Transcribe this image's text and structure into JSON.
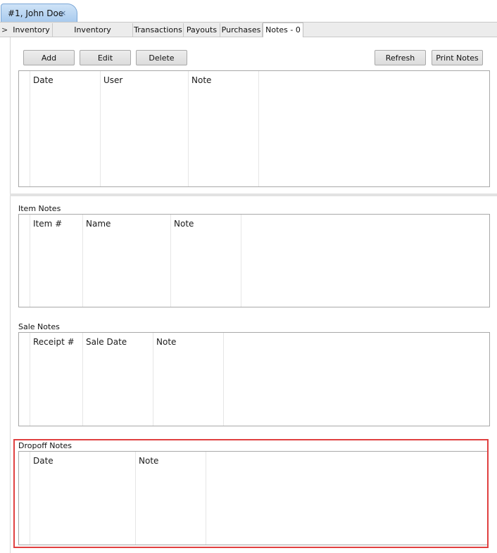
{
  "doc_tab": {
    "label": "#1, John Doe",
    "close_glyph": "×"
  },
  "subtabs": {
    "arrow": ">",
    "items": [
      "Inventory",
      "Inventory Disposition",
      "Transactions",
      "Payouts",
      "Purchases",
      "Notes - 0"
    ],
    "active": "Notes - 0"
  },
  "toolbar": {
    "add": "Add",
    "edit": "Edit",
    "delete": "Delete",
    "refresh": "Refresh",
    "print_notes": "Print Notes"
  },
  "notes_table": {
    "columns": [
      "Date",
      "User",
      "Note"
    ]
  },
  "item_notes": {
    "title": "Item Notes",
    "columns": [
      "Item #",
      "Name",
      "Note"
    ]
  },
  "sale_notes": {
    "title": "Sale Notes",
    "columns": [
      "Receipt #",
      "Sale Date",
      "Note"
    ]
  },
  "dropoff_notes": {
    "title": "Dropoff Notes",
    "columns": [
      "Date",
      "Note"
    ]
  },
  "colors": {
    "highlight": "#e04040",
    "tab_accent": "#a9cbee"
  }
}
